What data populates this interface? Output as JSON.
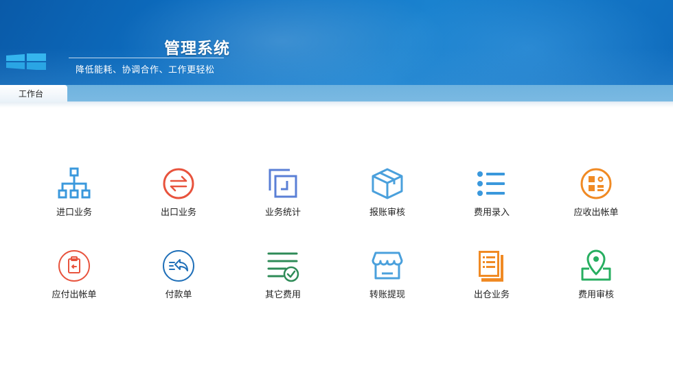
{
  "header": {
    "title": "管理系统",
    "subtitle": "降低能耗、协调合作、工作更轻松"
  },
  "tabs": [
    {
      "label": "工作台",
      "active": true
    }
  ],
  "grid": {
    "items": [
      {
        "label": "进口业务",
        "icon": "org-chart-icon",
        "color": "#3a98dc"
      },
      {
        "label": "出口业务",
        "icon": "exchange-icon",
        "color": "#e8533d"
      },
      {
        "label": "业务统计",
        "icon": "squares-stat-icon",
        "color": "#5a7fd6"
      },
      {
        "label": "报账审核",
        "icon": "box-icon",
        "color": "#4aa0dc"
      },
      {
        "label": "费用录入",
        "icon": "list-icon",
        "color": "#3a98dc"
      },
      {
        "label": "应收出帐单",
        "icon": "grid-gear-icon",
        "color": "#f08a24"
      },
      {
        "label": "应付出帐单",
        "icon": "clipboard-icon",
        "color": "#e8533d"
      },
      {
        "label": "付款单",
        "icon": "reply-arrow-icon",
        "color": "#1f6fb8"
      },
      {
        "label": "其它费用",
        "icon": "checklist-icon",
        "color": "#2e8b57"
      },
      {
        "label": "转账提现",
        "icon": "shop-icon",
        "color": "#4aa0dc"
      },
      {
        "label": "出仓业务",
        "icon": "document-stack-icon",
        "color": "#f08a24"
      },
      {
        "label": "费用审核",
        "icon": "map-pin-icon",
        "color": "#27ae60"
      }
    ]
  }
}
